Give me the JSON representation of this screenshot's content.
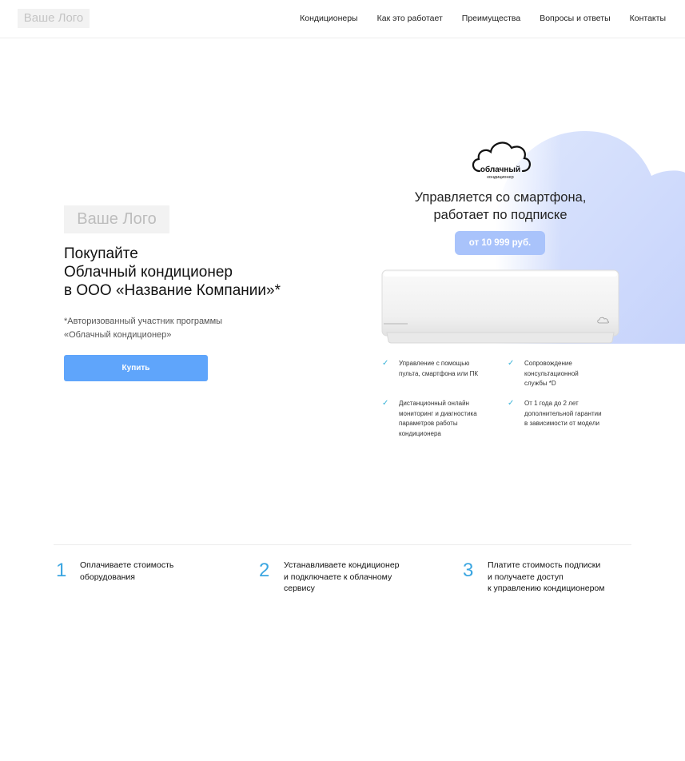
{
  "header": {
    "logo": "Ваше Лого",
    "nav": [
      "Кондиционеры",
      "Как это работает",
      "Преимущества",
      "Вопросы и ответы",
      "Контакты"
    ]
  },
  "hero": {
    "logo": "Ваше Лого",
    "title_lines": [
      "Покупайте",
      "Облачный кондиционер",
      "в ООО «Название Компании»*"
    ],
    "note_lines": [
      "*Авторизованный участник программы",
      "«Облачный кондиционер»"
    ],
    "buy_label": "Купить"
  },
  "product": {
    "cloud_logo_word": "облачный",
    "cloud_logo_sub": "кондиционер",
    "subtitle_lines": [
      "Управляется со смартфона,",
      "работает по подписке"
    ],
    "price": "от 10 999 руб.",
    "features": [
      {
        "lines": [
          "Управление с помощью",
          "пульта, смартфона или ПК"
        ]
      },
      {
        "lines": [
          "Сопровождение",
          "консультационной",
          "службы *D"
        ]
      },
      {
        "lines": [
          "Дистанционный онлайн",
          "мониторинг и диагностика",
          "параметров работы",
          "кондиционера"
        ]
      },
      {
        "lines": [
          "От 1 года до 2 лет",
          "дополнительной гарантии",
          "в зависимости от модели"
        ]
      }
    ],
    "check_icon": "check-icon",
    "accent_color": "#3ab3d8"
  },
  "steps": [
    {
      "num": "1",
      "lines": [
        "Оплачиваете стоимость",
        "оборудования"
      ]
    },
    {
      "num": "2",
      "lines": [
        "Устанавливаете кондиционер",
        "и подключаете к облачному",
        "сервису"
      ]
    },
    {
      "num": "3",
      "lines": [
        "Платите стоимость подписки",
        "и получаете доступ",
        "к управлению кондиционером"
      ]
    }
  ]
}
